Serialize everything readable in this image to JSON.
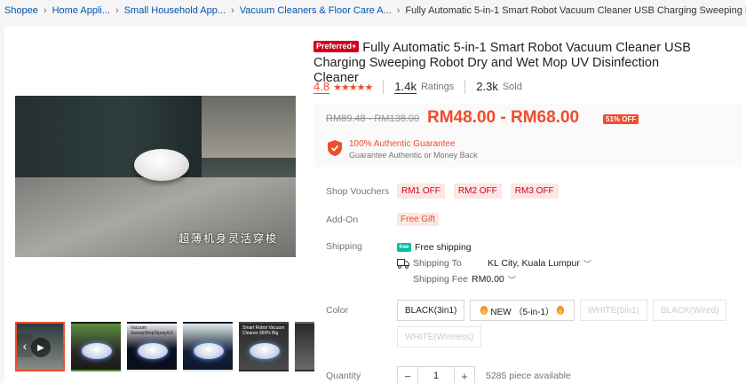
{
  "breadcrumb": {
    "items": [
      "Shopee",
      "Home Appli...",
      "Small Household App...",
      "Vacuum Cleaners & Floor Care A...",
      "Fully Automatic 5-in-1 Smart Robot Vacuum Cleaner USB Charging Sweeping Robot Dry and Wet M..."
    ],
    "separator": "›"
  },
  "gallery": {
    "caption": "超薄机身灵活穿梭",
    "thumb_texts": [
      "",
      "",
      "Vacuum Sweep/Mop/Spray/UV sterile",
      "",
      "Smart Robot Vacuum Cleaner 360% Big Suction"
    ],
    "icons": {
      "play": "play-icon",
      "arrow": "chevron-left-icon"
    }
  },
  "product": {
    "preferred_badge": "Preferred+",
    "title": "Fully Automatic 5-in-1 Smart Robot Vacuum Cleaner USB Charging Sweeping Robot Dry and Wet Mop UV Disinfection Cleaner",
    "rating": "4.8",
    "stars": "★★★★★",
    "ratings_count": "1.4k",
    "ratings_label": "Ratings",
    "sold_count": "2.3k",
    "sold_label": "Sold"
  },
  "price": {
    "original": "RM89.48 - RM138.00",
    "current": "RM48.00 - RM68.00",
    "discount": "51% OFF",
    "guarantee_title": "100% Authentic Guarantee",
    "guarantee_sub": "Guarantee Authentic or Money Back"
  },
  "vouchers": {
    "label": "Shop Vouchers",
    "items": [
      "RM1 OFF",
      "RM2 OFF",
      "RM3 OFF"
    ]
  },
  "addon": {
    "label": "Add-On",
    "value": "Free Gift"
  },
  "shipping": {
    "label": "Shipping",
    "free_icon_text": "free",
    "free": "Free shipping",
    "to_label": "Shipping To",
    "to_value": "KL City, Kuala Lumpur",
    "fee_label": "Shipping Fee",
    "fee_value": "RM0.00"
  },
  "color": {
    "label": "Color",
    "options": [
      {
        "text": "BLACK(3in1)",
        "disabled": false
      },
      {
        "text": "NEW （5-in-1）",
        "disabled": false
      },
      {
        "text": "WHITE(5in1)",
        "disabled": true
      },
      {
        "text": "BLACK(Wired)",
        "disabled": true
      },
      {
        "text": "WHITE(Wireless)",
        "disabled": true
      }
    ]
  },
  "quantity": {
    "label": "Quantity",
    "minus": "−",
    "value": "1",
    "plus": "+",
    "available": "5285 piece available"
  },
  "colors": {
    "accent": "#ee4d2d",
    "link": "#0055aa",
    "voucher_bg": "#fde7e3",
    "free_ship": "#00bfa5"
  }
}
